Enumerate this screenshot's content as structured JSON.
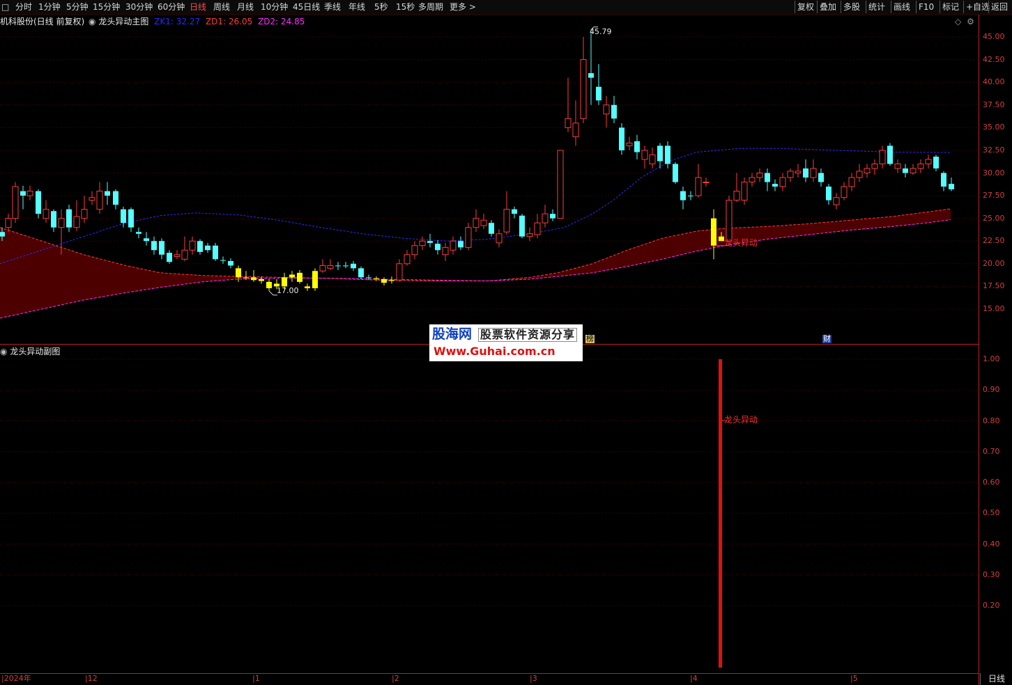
{
  "toolbar": {
    "periods": [
      "分时",
      "1分钟",
      "5分钟",
      "15分钟",
      "30分钟",
      "60分钟",
      "日线",
      "周线",
      "月线",
      "10分钟",
      "45日线",
      "季线",
      "年线",
      "5秒",
      "15秒",
      "多周期",
      "更多"
    ],
    "active_period": "日线",
    "right_buttons": [
      "复权",
      "叠加",
      "多股",
      "统计",
      "画线",
      "F10",
      "标记",
      "+自选",
      "返回"
    ]
  },
  "main_header": {
    "stock": "机科股份(日线 前复权)",
    "indicator": "龙头异动主图",
    "zk1": "ZK1: 32.27",
    "zd1": "ZD1: 26.05",
    "zd2": "ZD2: 24.85"
  },
  "sub_header": {
    "indicator": "龙头异动副图"
  },
  "price_axis": [
    "45.00",
    "42.50",
    "40.00",
    "37.50",
    "35.00",
    "32.50",
    "30.00",
    "27.50",
    "25.00",
    "22.50",
    "20.00",
    "17.50",
    "15.00"
  ],
  "sub_axis": [
    "1.00",
    "0.90",
    "0.80",
    "0.70",
    "0.60",
    "0.50",
    "0.40",
    "0.30",
    "0.20"
  ],
  "x_axis": [
    "2024年",
    "12",
    "1",
    "2",
    "3",
    "4",
    "5"
  ],
  "annotations": {
    "high": "45.79",
    "low": "17.00",
    "signal_main": "龙头异动",
    "signal_sub": "龙头异动",
    "tag_bang": "榜",
    "tag_cai": "财"
  },
  "bottom_tab": "日线",
  "watermark": {
    "brand": "股海网",
    "slogan": "股票软件资源分享",
    "url": "Www.Guhai.com.cn"
  },
  "colors": {
    "up": "#ff3b3b",
    "down": "#54ffff",
    "highlight": "#ffff00",
    "zk1": "#2a2aff",
    "zd1": "#ff3b3b",
    "zd2": "#ff2bff",
    "band": "#5a0000",
    "signal_bar": "#e01010"
  },
  "chart_data": {
    "type": "candlestick",
    "signal_value": 1.0,
    "price_high": 45.79,
    "price_low": 17.0
  }
}
